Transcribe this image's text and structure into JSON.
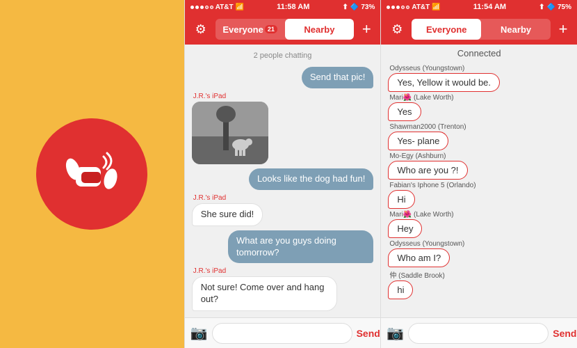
{
  "leftPanel": {
    "bgColor": "#F5B942"
  },
  "screen1": {
    "statusBar": {
      "dots": [
        true,
        true,
        true,
        false,
        false
      ],
      "carrier": "AT&T",
      "time": "11:58 AM",
      "location": true,
      "bluetooth": true,
      "battery": "73%"
    },
    "nav": {
      "everyone": "Everyone",
      "nearby": "Nearby",
      "badge": "21",
      "activeTab": "nearby"
    },
    "chatInfo": "2 people chatting",
    "messages": [
      {
        "type": "sent",
        "text": "Send that pic!",
        "sender": null
      },
      {
        "type": "image",
        "sender": "J.R.'s iPad"
      },
      {
        "type": "sent",
        "text": "Looks like the dog had fun!",
        "sender": null
      },
      {
        "type": "received",
        "text": "She sure did!",
        "sender": "J.R.'s iPad"
      },
      {
        "type": "sent",
        "text": "What are you guys doing tomorrow?",
        "sender": null
      },
      {
        "type": "received",
        "text": "Not sure! Come over and hang out?",
        "sender": "J.R.'s iPad"
      }
    ],
    "input": {
      "placeholder": "",
      "sendLabel": "Send"
    }
  },
  "screen2": {
    "statusBar": {
      "dots": [
        true,
        true,
        true,
        false,
        false
      ],
      "carrier": "AT&T",
      "time": "11:54 AM",
      "location": true,
      "bluetooth": true,
      "battery": "75%"
    },
    "nav": {
      "everyone": "Everyone",
      "nearby": "Nearby",
      "activeTab": "everyone"
    },
    "connectedLabel": "Connected",
    "messages": [
      {
        "sender": "Odysseus (Youngstown)",
        "text": "Yes, Yellow it would be."
      },
      {
        "sender": "Mari🌺 (Lake Worth)",
        "text": "Yes"
      },
      {
        "sender": "Shawman2000 (Trenton)",
        "text": "Yes- plane"
      },
      {
        "sender": "Mo-Egy (Ashburn)",
        "text": "Who are you ?!"
      },
      {
        "sender": "Fabian's Iphone 5 (Orlando)",
        "text": "Hi"
      },
      {
        "sender": "Mari🌺 (Lake Worth)",
        "text": "Hey"
      },
      {
        "sender": "Odysseus (Youngstown)",
        "text": "Who am I?"
      },
      {
        "sender": "仲 (Saddle Brook)",
        "text": "hi"
      }
    ],
    "input": {
      "sendLabel": "Send"
    }
  }
}
